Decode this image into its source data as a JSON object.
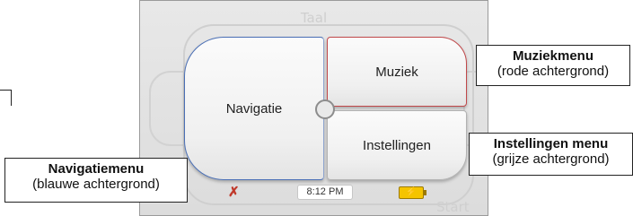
{
  "device": {
    "faded_title": "Taal",
    "faded_start": "Start",
    "buttons": {
      "navigation": "Navigatie",
      "music": "Muziek",
      "settings": "Instellingen"
    },
    "status": {
      "mute_icon": "mute-icon",
      "time": "8:12 PM",
      "battery_icon": "battery-charging-icon"
    },
    "accent_colors": {
      "navigation_border": "#4a6fb5",
      "music_border": "#c0484a",
      "settings_border": "#b2b2b2"
    }
  },
  "callouts": {
    "music": {
      "title": "Muziekmenu",
      "subtitle": "(rode achtergrond)"
    },
    "settings": {
      "title": "Instellingen menu",
      "subtitle": "(grijze achtergrond)"
    },
    "navigation": {
      "title": "Navigatiemenu",
      "subtitle": "(blauwe achtergrond)"
    }
  }
}
